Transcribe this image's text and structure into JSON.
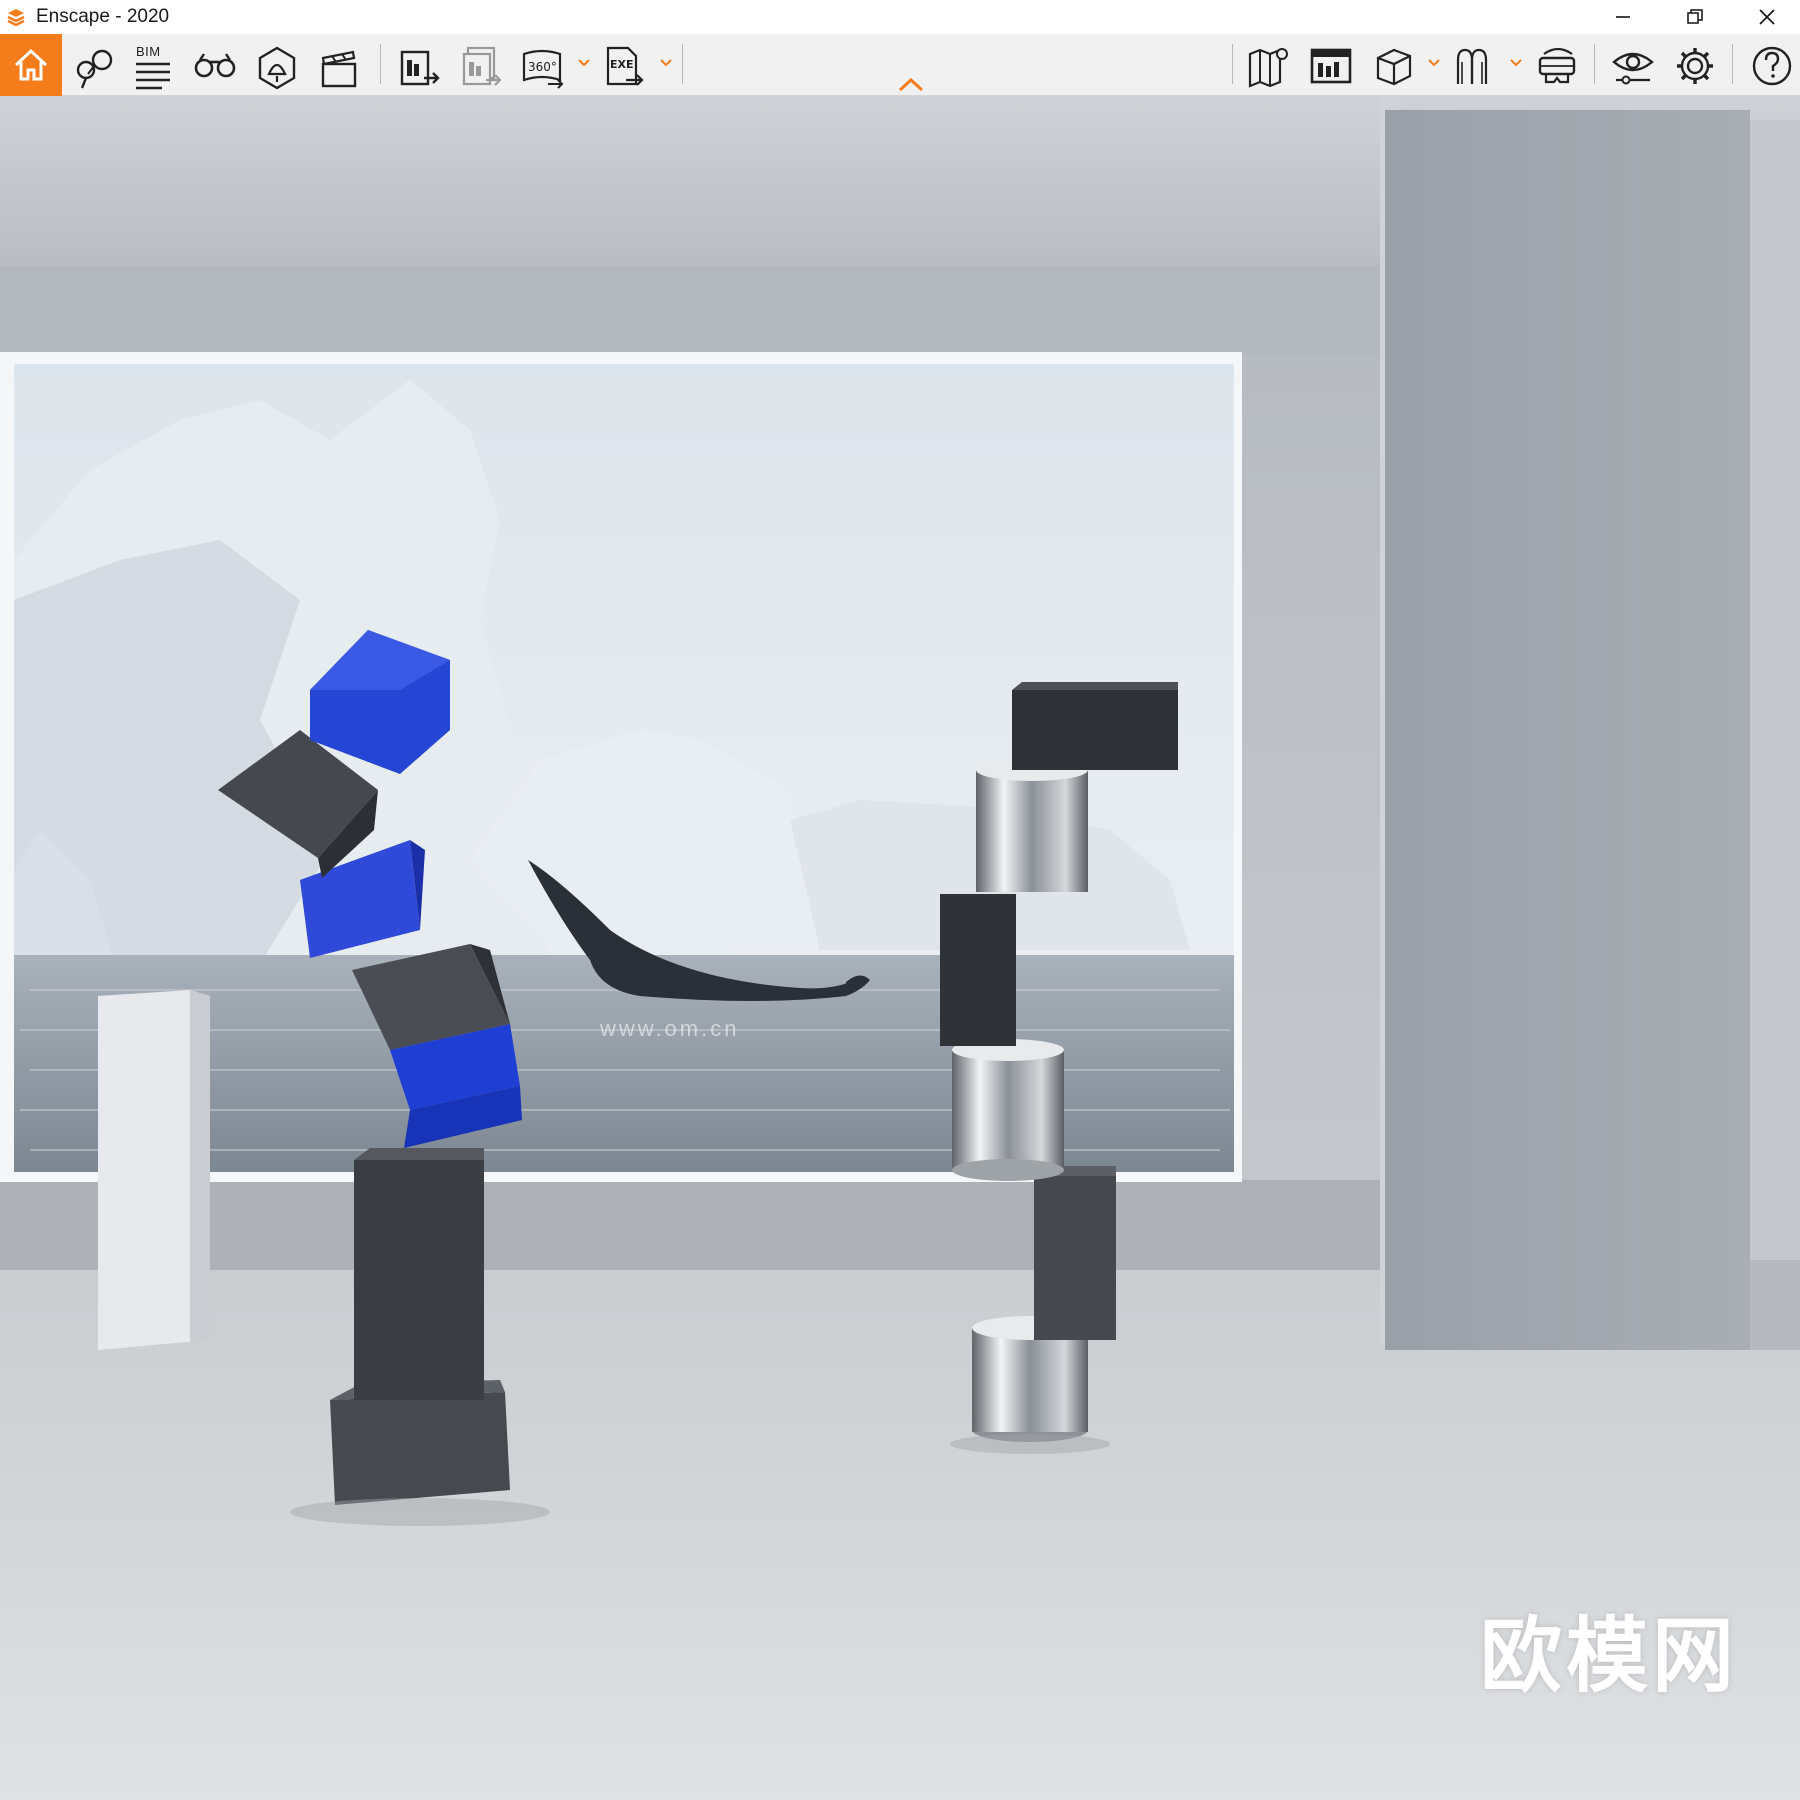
{
  "window": {
    "title": "Enscape - 2020",
    "accent_color": "#f47c1b"
  },
  "toolbar": {
    "bim_label": "BIM",
    "left_icons": [
      "home-icon",
      "location-pins-icon",
      "bim-info-icon",
      "binoculars-icon",
      "light-view-icon",
      "clapperboard-icon"
    ],
    "export_icons": [
      "screenshot-export-icon",
      "batch-render-icon",
      "panorama-360-icon",
      "standalone-exe-icon"
    ],
    "right_icons": [
      "map-icon",
      "render-gallery-icon",
      "asset-library-icon",
      "material-editor-icon",
      "vr-headset-icon",
      "visual-settings-icon",
      "settings-icon",
      "help-icon"
    ],
    "panorama_label": "360°",
    "exe_label": "EXE"
  },
  "viewport": {
    "watermark_text": "欧模网",
    "site_text": "www.om.cn"
  }
}
